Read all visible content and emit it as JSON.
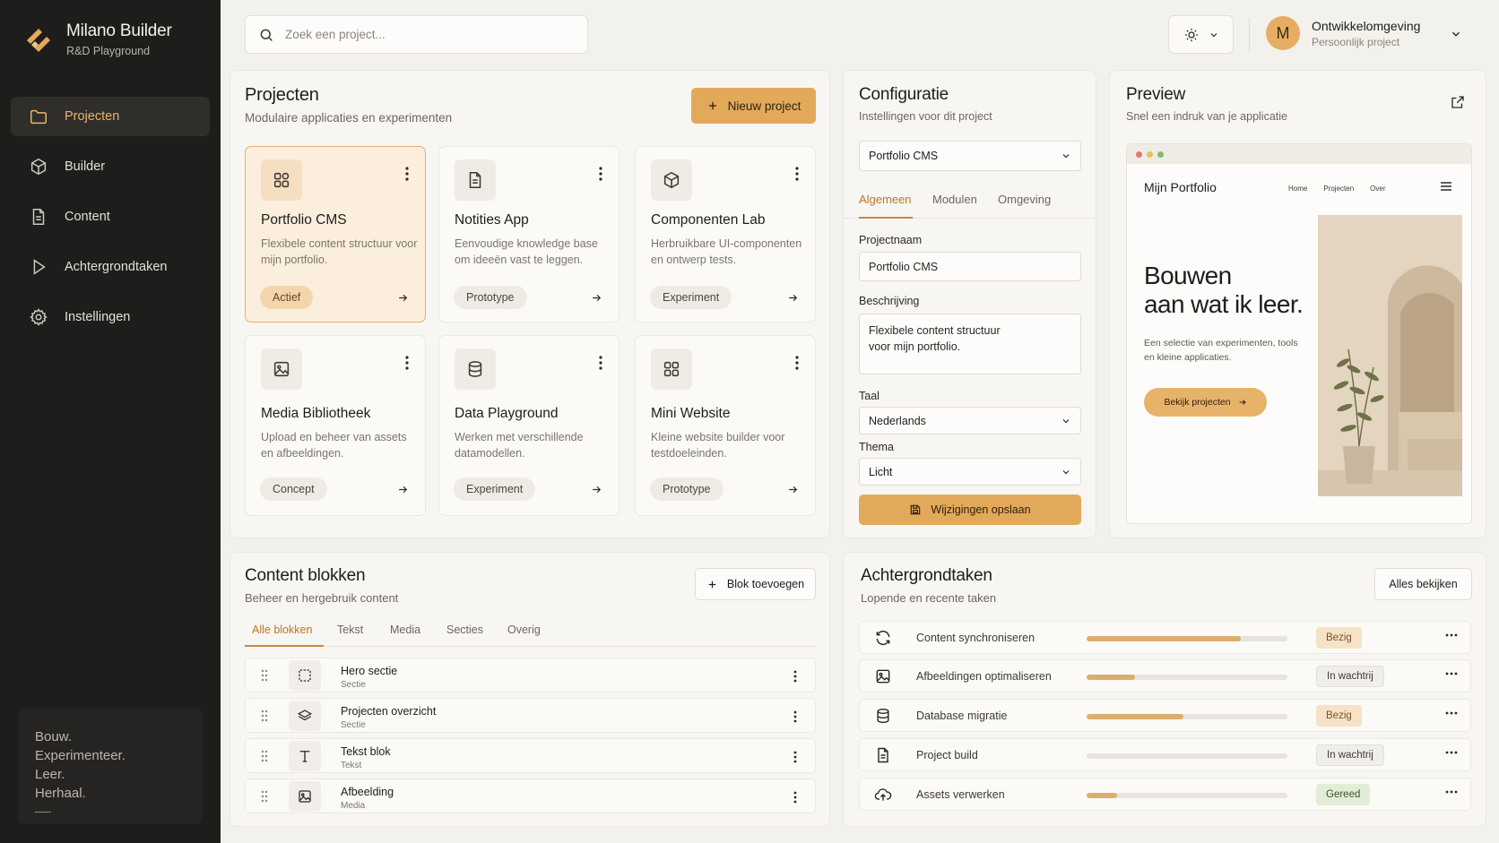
{
  "brand": {
    "title": "Milano Builder",
    "subtitle": "R&D Playground"
  },
  "sidebar": {
    "items": [
      {
        "label": "Projecten",
        "icon": "folder-icon",
        "active": true
      },
      {
        "label": "Builder",
        "icon": "cube-icon",
        "active": false
      },
      {
        "label": "Content",
        "icon": "document-icon",
        "active": false
      },
      {
        "label": "Achtergrondtaken",
        "icon": "play-icon",
        "active": false
      },
      {
        "label": "Instellingen",
        "icon": "gear-icon",
        "active": false
      }
    ],
    "motto": [
      "Bouw.",
      "Experimenteer.",
      "Leer.",
      "Herhaal."
    ]
  },
  "topbar": {
    "search_placeholder": "Zoek een project...",
    "theme_icon": "sun-icon",
    "user": {
      "initial": "M",
      "name": "Ontwikkelomgeving",
      "subtitle": "Persoonlijk project"
    }
  },
  "projects": {
    "title": "Projecten",
    "subtitle": "Modulaire applicaties en experimenten",
    "new_button": "Nieuw project",
    "cards": [
      {
        "title": "Portfolio CMS",
        "desc": "Flexibele content structuur voor mijn portfolio.",
        "badge": "Actief",
        "icon": "grid-icon",
        "active": true
      },
      {
        "title": "Notities App",
        "desc": "Eenvoudige knowledge base om ideeën vast te leggen.",
        "badge": "Prototype",
        "icon": "document-icon",
        "active": false
      },
      {
        "title": "Componenten Lab",
        "desc": "Herbruikbare UI-componenten en ontwerp tests.",
        "badge": "Experiment",
        "icon": "cube-icon",
        "active": false
      },
      {
        "title": "Media Bibliotheek",
        "desc": "Upload en beheer van assets en afbeeldingen.",
        "badge": "Concept",
        "icon": "image-icon",
        "active": false
      },
      {
        "title": "Data Playground",
        "desc": "Werken met verschillende datamodellen.",
        "badge": "Experiment",
        "icon": "database-icon",
        "active": false
      },
      {
        "title": "Mini Website",
        "desc": "Kleine website builder voor testdoeleinden.",
        "badge": "Prototype",
        "icon": "grid-icon",
        "active": false
      }
    ]
  },
  "config": {
    "title": "Configuratie",
    "subtitle": "Instellingen voor dit project",
    "project_select": "Portfolio CMS",
    "tabs": [
      "Algemeen",
      "Modulen",
      "Omgeving"
    ],
    "name_label": "Projectnaam",
    "name_value": "Portfolio CMS",
    "desc_label": "Beschrijving",
    "desc_value": "Flexibele content structuur\nvoor mijn portfolio.",
    "lang_label": "Taal",
    "lang_value": "Nederlands",
    "theme_label": "Thema",
    "theme_value": "Licht",
    "save_button": "Wijzigingen opslaan"
  },
  "preview": {
    "title": "Preview",
    "subtitle": "Snel een indruk van je applicatie",
    "site": {
      "logo": "Mijn Portfolio",
      "nav": [
        "Home",
        "Projecten",
        "Over"
      ],
      "headline_1": "Bouwen",
      "headline_2": "aan wat ik leer.",
      "text": "Een selectie van experimenten, tools en kleine applicaties.",
      "cta": "Bekijk projecten"
    }
  },
  "content_blocks": {
    "title": "Content blokken",
    "subtitle": "Beheer en hergebruik content",
    "add_button": "Blok toevoegen",
    "tabs": [
      "Alle blokken",
      "Tekst",
      "Media",
      "Secties",
      "Overig"
    ],
    "rows": [
      {
        "name": "Hero sectie",
        "type": "Sectie",
        "icon": "selection-icon"
      },
      {
        "name": "Projecten overzicht",
        "type": "Sectie",
        "icon": "layers-icon"
      },
      {
        "name": "Tekst blok",
        "type": "Tekst",
        "icon": "text-icon"
      },
      {
        "name": "Afbeelding",
        "type": "Media",
        "icon": "image-icon"
      }
    ]
  },
  "tasks": {
    "title": "Achtergrondtaken",
    "subtitle": "Lopende en recente taken",
    "view_all": "Alles bekijken",
    "rows": [
      {
        "name": "Content synchroniseren",
        "progress": 0.77,
        "status": "Bezig",
        "icon": "sync-icon"
      },
      {
        "name": "Afbeeldingen optimaliseren",
        "progress": 0.24,
        "status": "In wachtrij",
        "icon": "image-icon"
      },
      {
        "name": "Database migratie",
        "progress": 0.48,
        "status": "Bezig",
        "icon": "database-icon"
      },
      {
        "name": "Project build",
        "progress": 0.0,
        "status": "In wachtrij",
        "icon": "document-icon"
      },
      {
        "name": "Assets verwerken",
        "progress": 0.15,
        "status": "Gereed",
        "icon": "upload-cloud-icon"
      }
    ]
  },
  "colors": {
    "accent": "#e3a95a",
    "sidebar": "#1d1d1c",
    "background": "#f3f1ec"
  }
}
